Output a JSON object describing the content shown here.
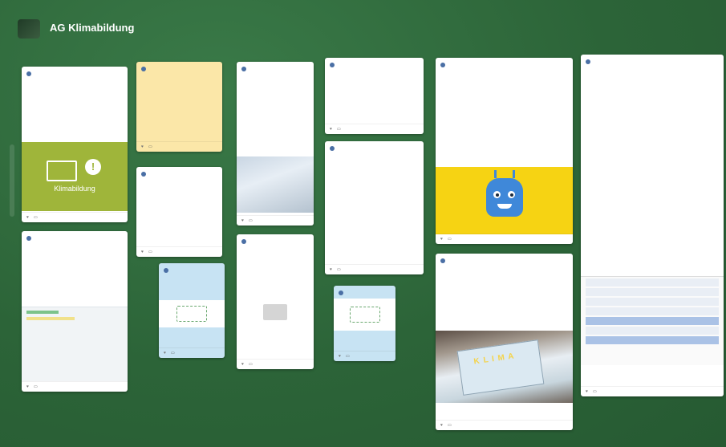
{
  "window": {
    "corner_label": ""
  },
  "board": {
    "breadcrumb": "",
    "title": "AG Klimabildung",
    "subtitle": "",
    "side_label": ""
  },
  "cards": [
    {
      "id": "c1",
      "author": "",
      "title": "",
      "lines": [],
      "graphic_label": "Klimabildung",
      "footer_count": ""
    },
    {
      "id": "c2",
      "author": "",
      "title": "",
      "lines": [],
      "footer_count": ""
    },
    {
      "id": "c3",
      "author": "",
      "title": "",
      "lines": [],
      "footer_count": ""
    },
    {
      "id": "c4",
      "author": "",
      "title": "",
      "lines": [],
      "footer_count": ""
    },
    {
      "id": "c5",
      "author": "",
      "title": "",
      "lines": [],
      "footer_count": ""
    },
    {
      "id": "c6",
      "author": "",
      "title": "",
      "lines": [],
      "footer_count": ""
    },
    {
      "id": "c7",
      "author": "",
      "title": "",
      "lines": [],
      "footer_count": ""
    },
    {
      "id": "c8",
      "author": "",
      "title": "",
      "lines": [],
      "footer_count": ""
    },
    {
      "id": "c9",
      "author": "",
      "title": "",
      "lines": [],
      "footer_count": ""
    },
    {
      "id": "c10",
      "author": "",
      "title": "",
      "lines": [],
      "footer_count": ""
    },
    {
      "id": "c11",
      "author": "",
      "title": "",
      "lines": [],
      "footer_count": ""
    },
    {
      "id": "c12",
      "author": "",
      "title": "",
      "lines": [],
      "footer_count": ""
    },
    {
      "id": "c13",
      "author": "",
      "title": "",
      "lines": [],
      "footer_count": ""
    },
    {
      "id": "c14",
      "author": "",
      "title": "",
      "lines": [],
      "footer_count": ""
    }
  ],
  "colors": {
    "board_bg": "#2f6b3e",
    "note_yellow": "#fbe7a8",
    "note_blue": "#c7e3f3",
    "accent_green": "#9fb53a",
    "accent_yellow": "#f6d313"
  },
  "icons": {
    "heart": "heart-icon",
    "comment": "comment-icon",
    "menu": "more-icon"
  }
}
